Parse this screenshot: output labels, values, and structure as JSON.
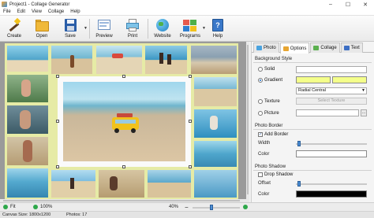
{
  "window": {
    "title": "Project1 - Collage Generator",
    "controls": [
      "–",
      "☐",
      "✕"
    ]
  },
  "menu": [
    "File",
    "Edit",
    "View",
    "Collage",
    "Help"
  ],
  "toolbar": {
    "create": "Create",
    "open": "Open",
    "save": "Save",
    "preview": "Preview",
    "print": "Print",
    "website": "Website",
    "programs": "Programs",
    "help": "Help"
  },
  "tabs": [
    "Photo",
    "Options",
    "Collage",
    "Text"
  ],
  "background": {
    "title": "Background Style",
    "solid": "Solid",
    "gradient": "Gradient",
    "texture": "Texture",
    "picture": "Picture",
    "gradient_mode": "Radial Central",
    "select_texture": "Select Texture",
    "gradient_colors": [
      "#f4ff8a",
      "#f4ff8a"
    ]
  },
  "photo_border": {
    "title": "Photo Border",
    "add_border": "Add Border",
    "width_label": "Width",
    "color_label": "Color",
    "color": "#ffffff"
  },
  "photo_shadow": {
    "title": "Photo Shadow",
    "drop_shadow": "Drop Shadow",
    "offset_label": "Offset",
    "color_label": "Color",
    "color": "#000000"
  },
  "zoom": {
    "fit": "Fit",
    "hundred": "100%",
    "level": "40%"
  },
  "status": {
    "canvas_size": "Canvas Size: 1800x1200",
    "photos": "Photos: 17"
  },
  "colors": {
    "collage_bg": "#e6eba6",
    "accent": "#1a6fd0"
  }
}
